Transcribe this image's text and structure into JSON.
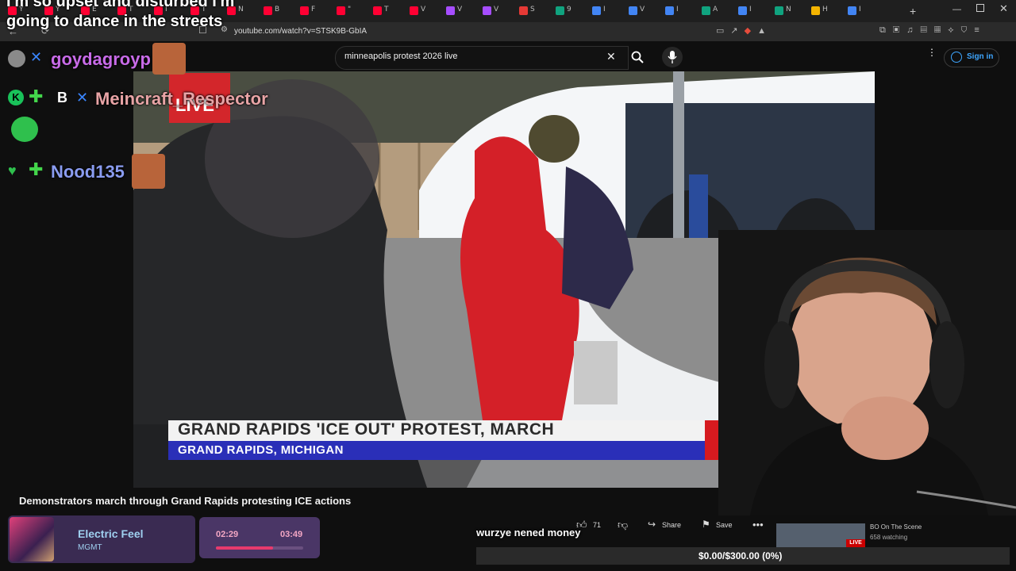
{
  "browser": {
    "url": "youtube.com/watch?v=STSK9B-GbIA",
    "tabs": [
      {
        "label": "Y",
        "color": "#ff0033"
      },
      {
        "label": "Y",
        "color": "#ff0033"
      },
      {
        "label": "E",
        "color": "#ff0033"
      },
      {
        "label": "T",
        "color": "#ff0033"
      },
      {
        "label": "I",
        "color": "#ff0033"
      },
      {
        "label": "T",
        "color": "#ff0033"
      },
      {
        "label": "N",
        "color": "#ff0033"
      },
      {
        "label": "B",
        "color": "#ff0033"
      },
      {
        "label": "F",
        "color": "#ff0033"
      },
      {
        "label": "\"",
        "color": "#ff0033"
      },
      {
        "label": "T",
        "color": "#ff0033"
      },
      {
        "label": "V",
        "color": "#ff0033"
      },
      {
        "label": "V",
        "color": "#a64dff"
      },
      {
        "label": "V",
        "color": "#a64dff"
      },
      {
        "label": "S",
        "color": "#e53935"
      },
      {
        "label": "9",
        "color": "#10a37f"
      },
      {
        "label": "I",
        "color": "#4285f4"
      },
      {
        "label": "V",
        "color": "#4285f4"
      },
      {
        "label": "I",
        "color": "#4285f4"
      },
      {
        "label": "A",
        "color": "#10a37f"
      },
      {
        "label": "I",
        "color": "#4285f4"
      },
      {
        "label": "N",
        "color": "#10a37f"
      },
      {
        "label": "H",
        "color": "#f4b400"
      },
      {
        "label": "I",
        "color": "#4285f4"
      }
    ]
  },
  "youtube": {
    "search_query": "minneapolis protest 2026 live",
    "sign_in_label": "Sign in",
    "video_title": "Demonstrators march through Grand Rapids protesting ICE actions",
    "lower_third_title": "GRAND RAPIDS 'ICE OUT' PROTEST, MARCH",
    "lower_third_subtitle": "GRAND RAPIDS, MICHIGAN",
    "live_label": "LIVE",
    "likes": "71",
    "share_label": "Share",
    "save_label": "Save",
    "recommended": {
      "title": "BO On The Scene",
      "watching": "658 watching",
      "live_label": "LIVE"
    }
  },
  "overlay": {
    "top_message_line1": "I'm so upset and disturbed I'm",
    "top_message_line2": "going to dance in the streets",
    "chat_users": [
      "goydagroyp",
      "Meincraft_Respector",
      "Nood135"
    ],
    "donation_message": "wurzye nened money",
    "goal_text": "$0.00/$300.00 (0%)",
    "goal_progress": 0
  },
  "music": {
    "title": "Electric Feel",
    "artist": "MGMT",
    "current_time": "02:29",
    "end_time": "03:49",
    "progress": 0.65
  }
}
